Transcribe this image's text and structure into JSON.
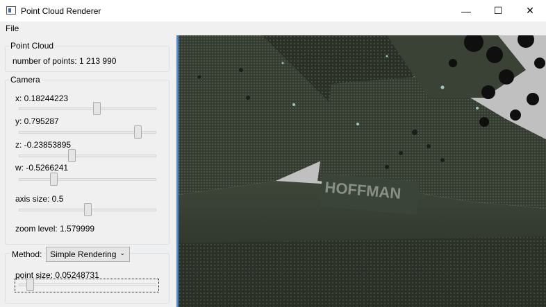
{
  "window": {
    "title": "Point Cloud Renderer",
    "minimize_glyph": "—",
    "maximize_glyph": "☐",
    "close_glyph": "✕"
  },
  "menu": {
    "file_label": "File"
  },
  "point_cloud_group": {
    "title": "Point Cloud",
    "points_label": "number of points: 1 213 990"
  },
  "camera_group": {
    "title": "Camera",
    "x_label": "x: 0.18244223",
    "x_value": 0.57,
    "y_label": "y: 0.795287",
    "y_value": 0.89,
    "z_label": "z: -0.23853895",
    "z_value": 0.38,
    "w_label": "w: -0.5266241",
    "w_value": 0.24,
    "axis_size_label": "axis size: 0.5",
    "axis_size_value": 0.5,
    "zoom_label": "zoom level: 1.579999"
  },
  "method_group": {
    "method_label": "Method:",
    "method_selected": "Simple Rendering",
    "point_size_label": "point size: 0.05248731",
    "point_size_value": 0.06
  },
  "viewport": {
    "sign_text": "HOFFMAN",
    "colors": {
      "background": "#c0c0c0",
      "cloud_dark": "#2b3128",
      "cloud_mid": "#4a5344",
      "accent": "#4d8ad6"
    }
  }
}
